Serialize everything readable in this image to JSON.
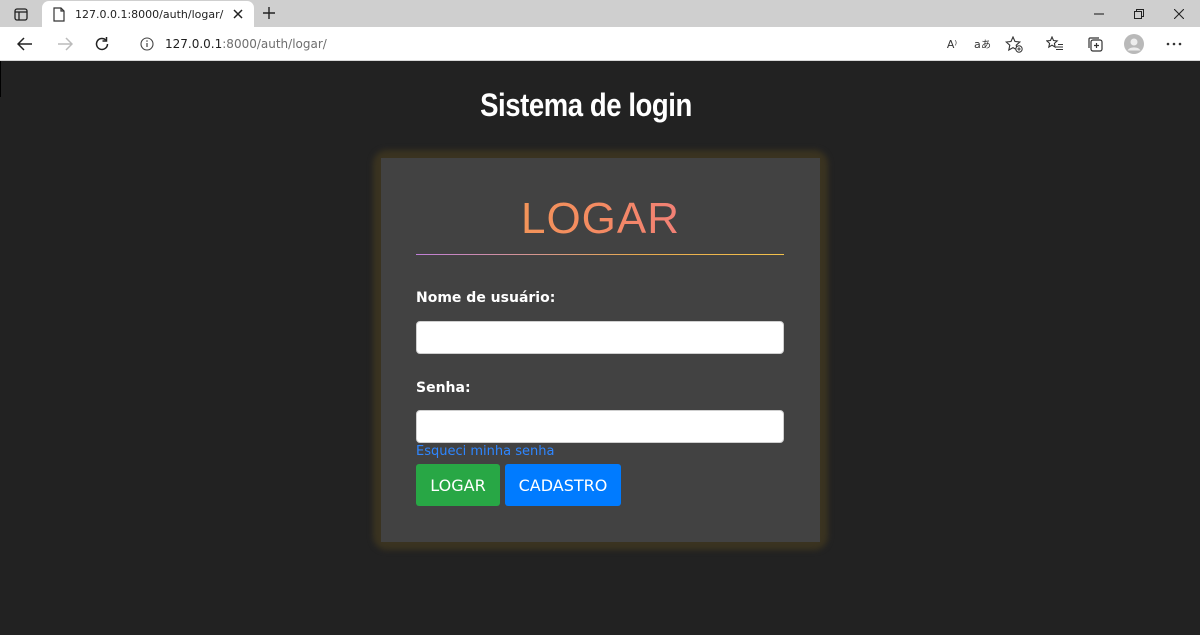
{
  "browser": {
    "tab_title": "127.0.0.1:8000/auth/logar/",
    "url_host": "127.0.0.1",
    "url_rest": ":8000/auth/logar/",
    "read_aloud_label": "A⁾"
  },
  "page": {
    "title": "Sistema de login"
  },
  "login_card": {
    "heading": "LOGAR",
    "username_label": "Nome de usuário:",
    "username_value": "",
    "password_label": "Senha:",
    "password_value": "",
    "forgot_link": "Esqueci minha senha",
    "login_button": "LOGAR",
    "register_button": "CADASTRO"
  },
  "colors": {
    "page_background": "#222222",
    "card_background": "#424242",
    "login_button": "#28a745",
    "register_button": "#007bff",
    "link": "#2e86ff"
  }
}
